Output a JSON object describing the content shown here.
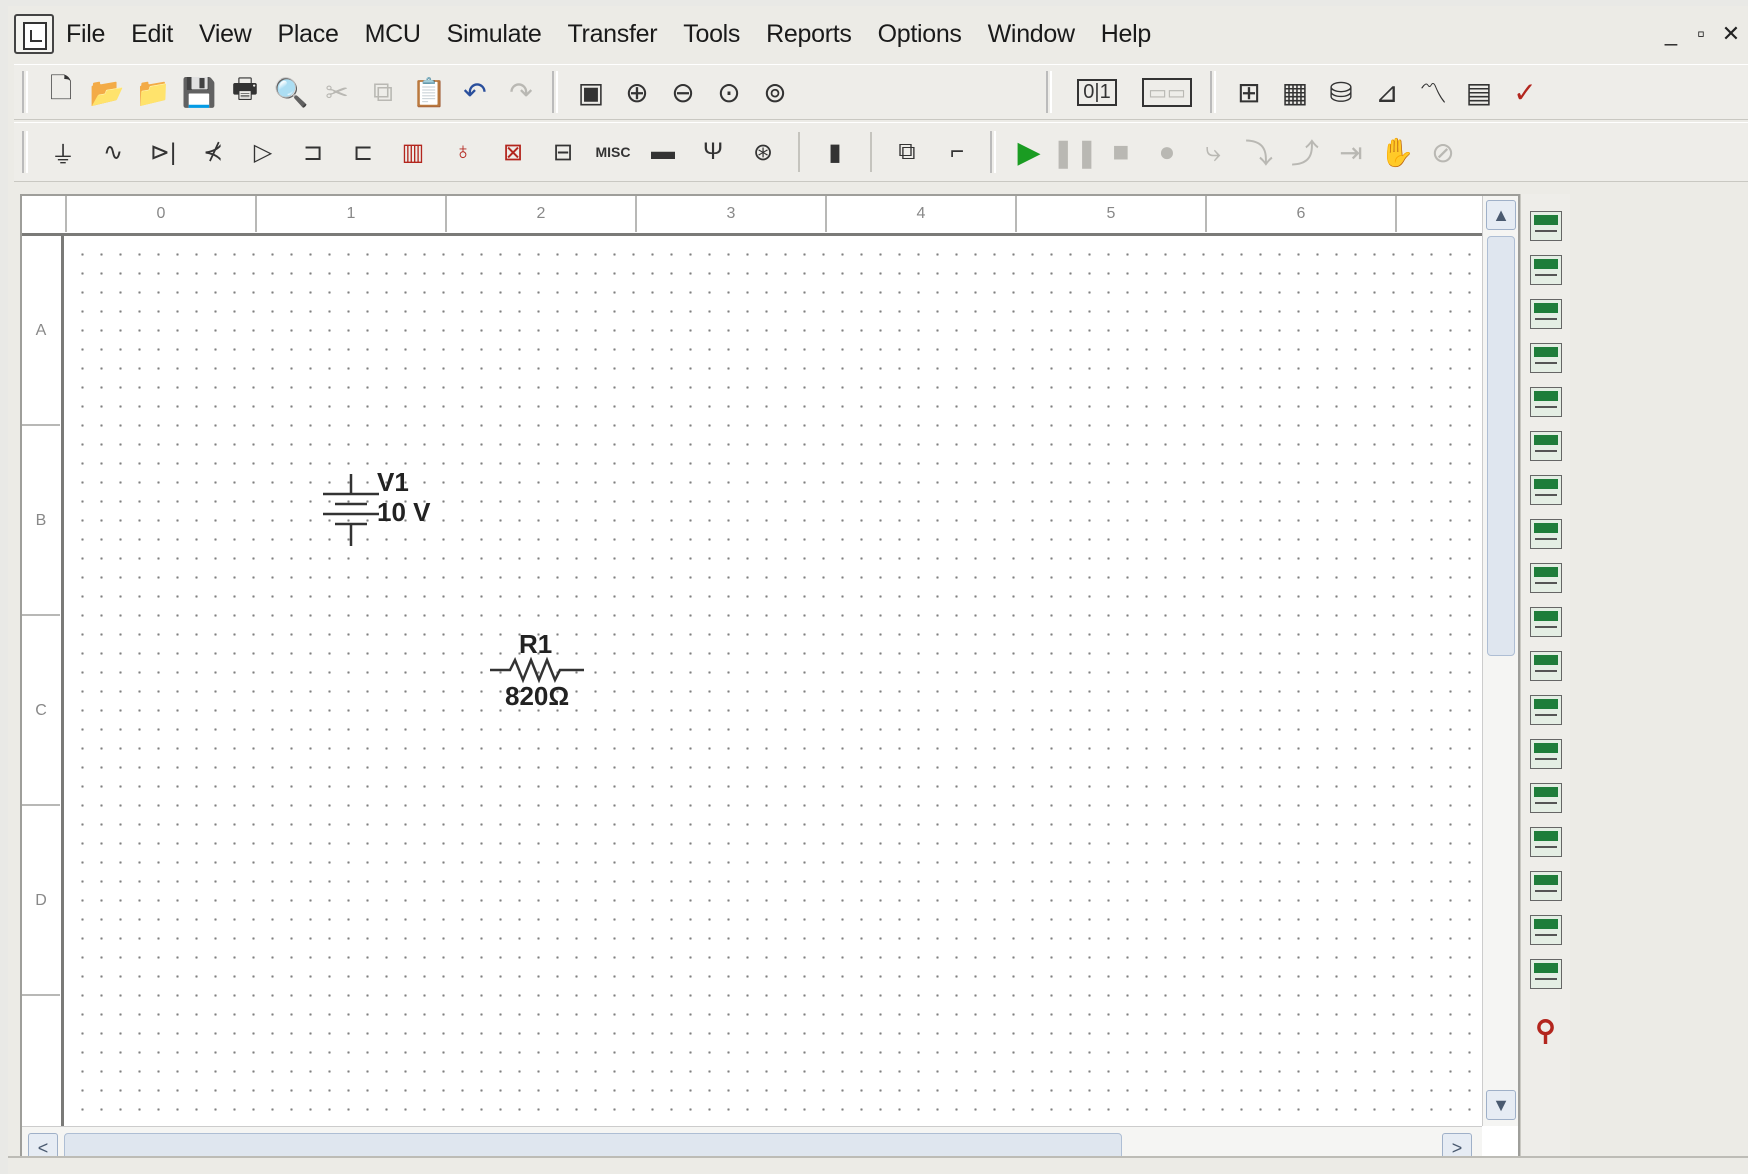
{
  "menu": [
    "File",
    "Edit",
    "View",
    "Place",
    "MCU",
    "Simulate",
    "Transfer",
    "Tools",
    "Reports",
    "Options",
    "Window",
    "Help"
  ],
  "window_controls": [
    "_",
    "▫",
    "✕"
  ],
  "ruler": {
    "columns": [
      "0",
      "1",
      "2",
      "3",
      "4",
      "5",
      "6"
    ],
    "rows": [
      "A",
      "B",
      "C",
      "D"
    ]
  },
  "components": {
    "v1": {
      "name": "V1",
      "value": "10 V"
    },
    "r1": {
      "name": "R1",
      "value": "820Ω"
    }
  },
  "scroll": {
    "up": "▲",
    "down": "▼",
    "left": "<",
    "right": ">"
  },
  "icons": {
    "toolbar1": [
      "new-file-icon",
      "open-icon",
      "open-samples-icon",
      "save-icon",
      "print-icon",
      "print-preview-icon",
      "cut-icon",
      "copy-icon",
      "paste-icon",
      "undo-icon",
      "redo-icon",
      "full-screen-icon",
      "zoom-in-icon",
      "zoom-out-icon",
      "zoom-area-icon",
      "zoom-fit-icon"
    ],
    "toolbar2": [
      "source-icon",
      "basic-icon",
      "diode-icon",
      "transistor-icon",
      "analog-icon",
      "ttl-icon",
      "cmos-icon",
      "misc-digital-icon",
      "mixed-icon",
      "indicator-icon",
      "power-icon",
      "misc-icon",
      "peripheral-icon",
      "rf-icon",
      "electromech-icon",
      "mcu-icon",
      "hierarchical-icon",
      "bus-icon",
      "run-icon",
      "pause-icon",
      "stop-icon",
      "probe-icon"
    ]
  }
}
